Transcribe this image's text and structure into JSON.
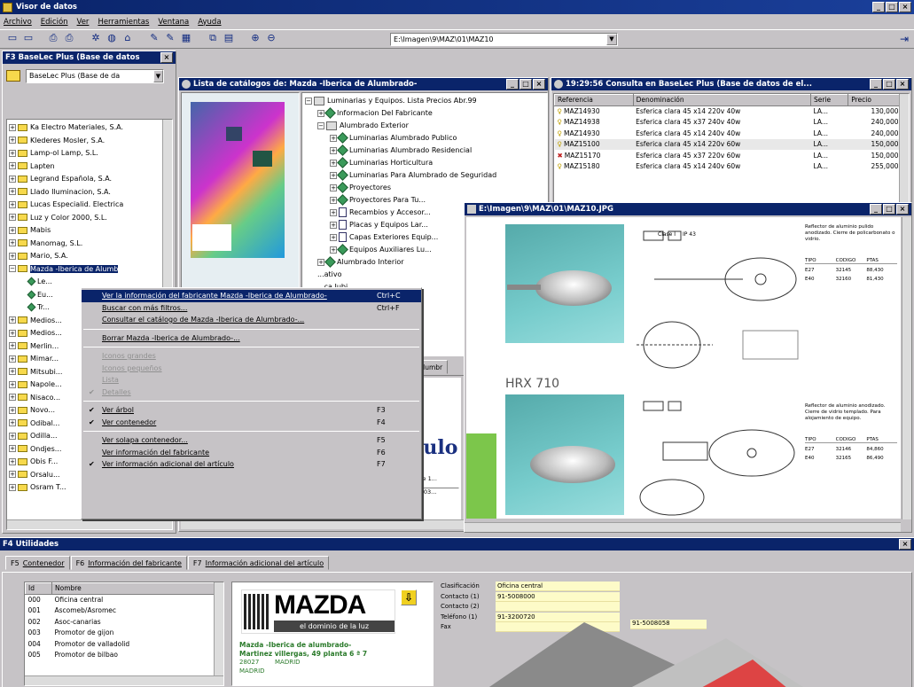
{
  "app": {
    "title": "Visor de datos",
    "menu": [
      "Archivo",
      "Edición",
      "Ver",
      "Herramientas",
      "Ventana",
      "Ayuda"
    ],
    "path_value": "E:\\Imagen\\9\\MAZ\\01\\MAZ10",
    "toolbar_icons": [
      "new-window-icon",
      "split-window-icon",
      "print-preview-icon",
      "print-icon",
      "settings-icon",
      "globe-icon",
      "network-icon",
      "pin-icon",
      "brush-icon",
      "chart-icon",
      "copy-icon",
      "paste-icon",
      "zoom-in-icon",
      "zoom-out-icon"
    ]
  },
  "left_panel": {
    "title": "F3 BaseLec Plus (Base de datos",
    "base_select": "BaseLec Plus (Base de da",
    "tree": [
      "Ka Electro Materiales, S.A.",
      "Klederes Mosler, S.A.",
      "Lamp-ol Lamp, S.L.",
      "Lapten",
      "Legrand Española, S.A.",
      "Llado Iluminacion, S.A.",
      "Lucas Especialid. Electrica",
      "Luz y Color 2000, S.L.",
      "Mabis",
      "Manomag, S.L.",
      "Mario, S.A.",
      "Mazda -Iberica de Alumb",
      "Le...",
      "Eu...",
      "Tr...",
      "Medios...",
      "Medios...",
      "Merlin...",
      "Mimar...",
      "Mitsubi...",
      "Napole...",
      "Nisaco...",
      "Novo...",
      "Odibal...",
      "Odilla...",
      "Ondjes...",
      "Obis F...",
      "Orsalu...",
      "Osram T..."
    ]
  },
  "catalog_window": {
    "title": "Lista de catálogos de: Mazda -Iberica de Alumbrado-",
    "tree": [
      {
        "d": 0,
        "text": "Luminarias y Equipos. Lista Precios Abr.99",
        "icon": "book"
      },
      {
        "d": 1,
        "text": "Informacion Del Fabricante",
        "icon": "dia"
      },
      {
        "d": 1,
        "text": "Alumbrado Exterior",
        "icon": "book"
      },
      {
        "d": 2,
        "text": "Luminarias Alumbrado Publico",
        "icon": "dia"
      },
      {
        "d": 2,
        "text": "Luminarias Alumbrado Residencial",
        "icon": "dia"
      },
      {
        "d": 2,
        "text": "Luminarias Horticultura",
        "icon": "dia"
      },
      {
        "d": 2,
        "text": "Luminarias Para Alumbrado de Seguridad",
        "icon": "dia"
      },
      {
        "d": 2,
        "text": "Proyectores",
        "icon": "dia"
      },
      {
        "d": 2,
        "text": "Proyectores Para Tu...",
        "icon": "dia"
      },
      {
        "d": 2,
        "text": "Recambios y Accesor...",
        "icon": "doc"
      },
      {
        "d": 2,
        "text": "Placas y Equipos Lar...",
        "icon": "doc"
      },
      {
        "d": 2,
        "text": "Capas Exteriores Equip...",
        "icon": "doc"
      },
      {
        "d": 2,
        "text": "Equipos Auxiliares Lu...",
        "icon": "dia"
      },
      {
        "d": 1,
        "text": "Alumbrado Interior",
        "icon": "dia"
      },
      {
        "d": 1,
        "text": "...ativo",
        "icon": "none"
      },
      {
        "d": 1,
        "text": "...ca Jubi...",
        "icon": "none"
      }
    ],
    "bottom_label": "Alumbr",
    "big_text": "culo",
    "ref_label": "Refe 1...",
    "ref_value": "EU03..."
  },
  "query_window": {
    "title": "19:29:56 Consulta en BaseLec Plus (Base de datos de el...",
    "headers": [
      "Referencia",
      "Denominación",
      "Serie",
      "Precio"
    ],
    "rows": [
      {
        "ref": "MAZ14930",
        "den": "Esferica clara 45 x14 220v 40w",
        "serie": "LA...",
        "precio": "130,000"
      },
      {
        "ref": "MAZ14938",
        "den": "Esferica clara 45 x37 240v 40w",
        "serie": "LA...",
        "precio": "240,000"
      },
      {
        "ref": "MAZ14930",
        "den": "Esferica clara 45 x14 240v 40w",
        "serie": "LA...",
        "precio": "240,000"
      },
      {
        "ref": "MAZ15100",
        "den": "Esferica clara 45 x14 220v 60w",
        "serie": "LA...",
        "precio": "150,000"
      },
      {
        "ref": "MAZ15170",
        "den": "Esferica clara 45 x37 220v 60w",
        "serie": "LA...",
        "precio": "150,000"
      },
      {
        "ref": "MAZ15180",
        "den": "Esferica clara 45 x14 240v 60w",
        "serie": "LA...",
        "precio": "255,000"
      }
    ]
  },
  "image_window": {
    "title": "E:\\Imagen\\9\\MAZ\\01\\MAZ10.JPG",
    "product_label": "HRX 710",
    "spec_text_1": "Reflector de aluminio pulido anodizado. Cierre de policarbonato o vidrio.",
    "spec_text_2": "Reflector de aluminio anodizado. Cierre de vidrio templado. Para alojamiento de equipo.",
    "spec_header": [
      "TIPO",
      "CODIGO",
      "PTAS"
    ],
    "spec_rows_1": [
      [
        "E27",
        "32145",
        "88,430"
      ],
      [
        "E40",
        "32160",
        "81,430"
      ]
    ],
    "spec_rows_2": [
      [
        "E27",
        "32146",
        "84,860"
      ],
      [
        "E40",
        "32165",
        "86,490"
      ]
    ],
    "page_label": "MAZ10",
    "clase_label": "Clase I",
    "ip_label": "IP 43"
  },
  "context_menu": {
    "items": [
      {
        "label": "Ver la información del fabricante Mazda -Iberica de Alumbrado-",
        "shortcut": "Ctrl+C",
        "state": "selected"
      },
      {
        "label": "Buscar con más filtros...",
        "shortcut": "Ctrl+F",
        "state": ""
      },
      {
        "label": "Consultar el catálogo de Mazda -Iberica de Alumbrado-...",
        "shortcut": "",
        "state": ""
      },
      {
        "sep": true
      },
      {
        "label": "Borrar Mazda -Iberica de Alumbrado-...",
        "shortcut": "",
        "state": ""
      },
      {
        "sep": true
      },
      {
        "label": "Iconos grandes",
        "shortcut": "",
        "state": "dis"
      },
      {
        "label": "Iconos pequeños",
        "shortcut": "",
        "state": "dis"
      },
      {
        "label": "Lista",
        "shortcut": "",
        "state": "dis"
      },
      {
        "label": "Detalles",
        "shortcut": "",
        "state": "dis-check"
      },
      {
        "sep": true
      },
      {
        "label": "Ver árbol",
        "shortcut": "F3",
        "state": "check"
      },
      {
        "label": "Ver contenedor",
        "shortcut": "F4",
        "state": "check"
      },
      {
        "sep": true
      },
      {
        "label": "Ver solapa contenedor...",
        "shortcut": "F5",
        "state": ""
      },
      {
        "label": "Ver información del fabricante",
        "shortcut": "F6",
        "state": ""
      },
      {
        "label": "Ver información adicional del artículo",
        "shortcut": "F7",
        "state": "check"
      }
    ]
  },
  "utilities": {
    "title": "F4 Utilidades",
    "tabs": [
      {
        "key": "F5",
        "label": "Contenedor"
      },
      {
        "key": "F6",
        "label": "Información del fabricante"
      },
      {
        "key": "F7",
        "label": "Información adicional del artículo"
      }
    ],
    "list_headers": [
      "Id",
      "Nombre"
    ],
    "list_rows": [
      [
        "000",
        "Oficina central"
      ],
      [
        "001",
        "Ascomeb/Asromec"
      ],
      [
        "002",
        "Asoc-canarias"
      ],
      [
        "003",
        "Promotor de gijon"
      ],
      [
        "004",
        "Promotor de valladolid"
      ],
      [
        "005",
        "Promotor de bilbao"
      ]
    ],
    "logo_text": "MAZDA",
    "logo_tagline": "el dominio de la luz",
    "company_name": "Mazda -Iberica de alumbrado-",
    "company_address": "Martinez villergas, 49 planta 6 ª 7",
    "company_zip": "28027",
    "company_city": "MADRID",
    "company_region": "MADRID",
    "fields": [
      {
        "label": "Clasificación",
        "value": "Oficina central"
      },
      {
        "label": "Contacto (1)",
        "value": "91-5008000"
      },
      {
        "label": "Contacto (2)",
        "value": ""
      },
      {
        "label": "Teléfono (1)",
        "value": "91-3200720"
      },
      {
        "label": "Fax",
        "value": ""
      }
    ],
    "extra_phone": "91-5008058"
  },
  "colors": {
    "titlebar": "#0a246a",
    "teal_bg": "#7fb4b8",
    "yellow_field": "#fdfbc8"
  }
}
